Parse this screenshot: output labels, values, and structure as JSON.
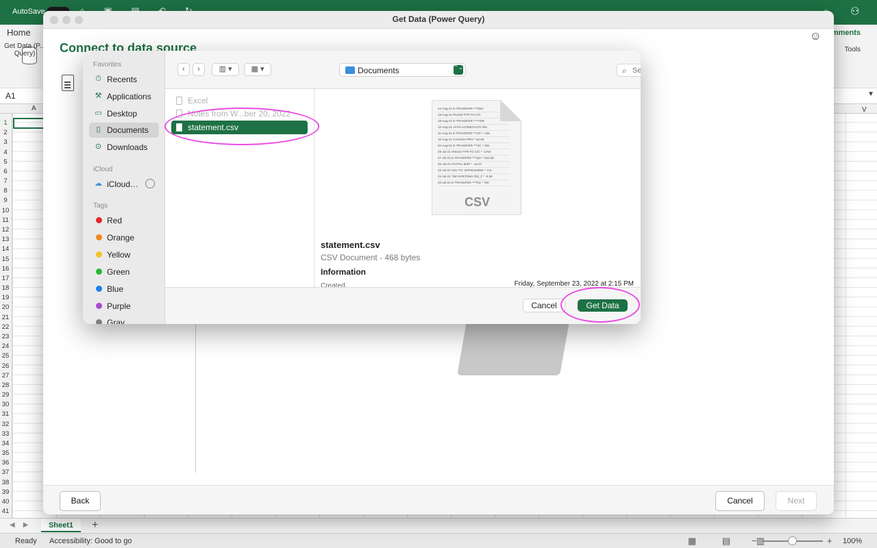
{
  "excel": {
    "autosave_label": "AutoSave",
    "toolbar_icons": "⌂ ▣ ▤ ↶ ↻",
    "right_icons": "⌕ ⚇",
    "home_tab": "Home",
    "comments_label": "omments",
    "tools_label": "Tools",
    "get_data_label": "Get Data (P... Query)",
    "name_box": "A1",
    "column_a": "A",
    "column_v": "V",
    "rows": [
      "1",
      "2",
      "3",
      "4",
      "5",
      "6",
      "7",
      "8",
      "9",
      "10",
      "11",
      "12",
      "13",
      "14",
      "15",
      "16",
      "17",
      "18",
      "19",
      "20",
      "21",
      "22",
      "23",
      "24",
      "25",
      "26",
      "27",
      "28",
      "29",
      "30",
      "31",
      "32",
      "33",
      "34",
      "35",
      "36",
      "37",
      "38",
      "39",
      "40",
      "41"
    ],
    "sheet_tab": "Sheet1",
    "add_sheet": "+",
    "status_ready": "Ready",
    "accessibility": "Accessibility: Good to go",
    "view_icons": "▦ ▤ ▥",
    "zoom_minus": "−",
    "zoom_plus": "+",
    "zoom_level": "100%"
  },
  "power_query": {
    "title": "Get Data (Power Query)",
    "heading": "Connect to data source",
    "smiley": "☺",
    "back_button": "Back",
    "cancel_button": "Cancel",
    "next_button": "Next"
  },
  "file_dialog": {
    "sidebar": {
      "favorites_header": "Favorites",
      "favorites": [
        {
          "label": "Recents",
          "icon": "⏱"
        },
        {
          "label": "Applications",
          "icon": "⚒"
        },
        {
          "label": "Desktop",
          "icon": "▭"
        },
        {
          "label": "Documents",
          "icon": "▯"
        },
        {
          "label": "Downloads",
          "icon": "⊙"
        }
      ],
      "icloud_header": "iCloud",
      "icloud_item": "iCloud…",
      "cloud_icon": "☁",
      "tags_header": "Tags",
      "tags": [
        {
          "label": "Red",
          "color": "#e8272b"
        },
        {
          "label": "Orange",
          "color": "#f5841f"
        },
        {
          "label": "Yellow",
          "color": "#f6c12c"
        },
        {
          "label": "Green",
          "color": "#2bb534"
        },
        {
          "label": "Blue",
          "color": "#1f7ff0"
        },
        {
          "label": "Purple",
          "color": "#a84ad3"
        },
        {
          "label": "Gray",
          "color": "#7d7d7d"
        }
      ]
    },
    "toolbar": {
      "back_arrow": "‹",
      "forward_arrow": "›",
      "column_view": "▥ ▾",
      "grid_view": "▦ ▾",
      "location": "Documents",
      "location_stepper": "⌃⌄",
      "search_icon": "⌕",
      "search_placeholder": "Search"
    },
    "files": [
      {
        "label": "Excel",
        "state": "dim"
      },
      {
        "label": "Notes from W...ber 20, 2022",
        "state": "dim"
      },
      {
        "label": "statement.csv",
        "state": "selected"
      }
    ],
    "preview": {
      "thumb_rows": [
        "24-Aug-21  E-TRANSFER ***SbG",
        "18-Aug-21  RU193 TFR-TO C/C",
        "16-Aug-21  E-TRANSFER ***YSW",
        "12-Aug-21  AVIVA-HOME/AUTO INS",
        "11-Aug-21  E-TRANSFER ***eFr   *  248",
        "10-Aug-21  CANADA PRO          *  52.66",
        "04-Aug-21  E-TRANSFER ***3rc   *  281",
        "28-Jul-21  HW154 TFR-TO C/C    *  -1700",
        "27-Jul-21  E-TRANSFER ***eym   *  634.99",
        "26-Jul-21  PAYPAL MSP          *  -16.07",
        "23-Jul-21  SSV TO: 00766246594 *  -0.5",
        "22-Jul-21  TIM HORTONS #02_F   *  -5.06",
        "20-Jul-21  E-TRANSFER ***Tby   *  750"
      ],
      "thumb_label": "CSV",
      "file_name": "statement.csv",
      "file_kind": "CSV Document - 468 bytes",
      "info_title": "Information",
      "created_label": "Created",
      "created_value": "Friday, September 23, 2022 at 2:15 PM"
    },
    "cancel_button": "Cancel",
    "get_data_button": "Get Data"
  },
  "colors": {
    "excel_green": "#1e7145",
    "annotation": "#e84ce3"
  }
}
